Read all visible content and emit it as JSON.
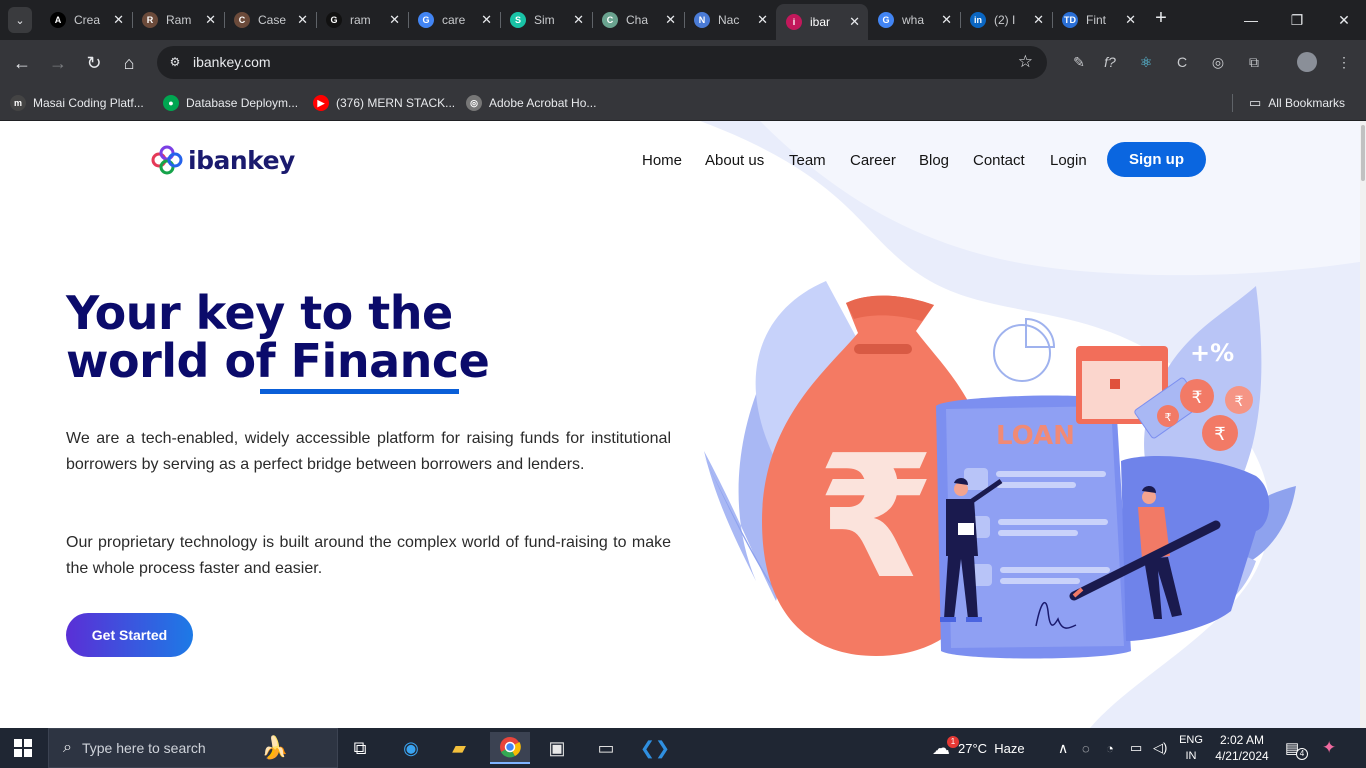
{
  "browser": {
    "tabs": [
      {
        "title": "Crea",
        "favicon": "A",
        "color": "#000000"
      },
      {
        "title": "Ram",
        "favicon": "R",
        "color": "#6b4a3a"
      },
      {
        "title": "Case",
        "favicon": "C",
        "color": "#6b4a3a"
      },
      {
        "title": "ram",
        "favicon": "G",
        "color": "#111111"
      },
      {
        "title": "care",
        "favicon": "G",
        "color": "#4285f4"
      },
      {
        "title": "Sim",
        "favicon": "S",
        "color": "#19c3a6"
      },
      {
        "title": "Cha",
        "favicon": "C",
        "color": "#6aa38f"
      },
      {
        "title": "Nac",
        "favicon": "N",
        "color": "#4a7bd6"
      },
      {
        "title": "ibar",
        "favicon": "i",
        "color": "#c2185b"
      },
      {
        "title": "wha",
        "favicon": "G",
        "color": "#4285f4"
      },
      {
        "title": "(2) I",
        "favicon": "in",
        "color": "#0a66c2"
      },
      {
        "title": "Fint",
        "favicon": "TD",
        "color": "#2a6fd6"
      }
    ],
    "active_tab_index": 8,
    "url": "ibankey.com",
    "bookmarks": [
      {
        "label": "Masai Coding Platf...",
        "icon": "m",
        "color": "#444444"
      },
      {
        "label": "Database Deploym...",
        "icon": "●",
        "color": "#00a651"
      },
      {
        "label": "(376) MERN STACK...",
        "icon": "▶",
        "color": "#ff0000"
      },
      {
        "label": "Adobe Acrobat Ho...",
        "icon": "◎",
        "color": "#777777"
      }
    ],
    "all_bookmarks": "All Bookmarks"
  },
  "site": {
    "logo_text": "ibankey",
    "nav": [
      "Home",
      "About us",
      "Team",
      "Career",
      "Blog",
      "Contact",
      "Login"
    ],
    "signup": "Sign up",
    "hero": {
      "title_line1": "Your key to the",
      "title_line2_prefix": "world of ",
      "title_line2_accent": "Finance",
      "para1": "We are a tech-enabled, widely accessible platform for raising funds for institutional borrowers by serving as a perfect bridge between borrowers and lenders.",
      "para2": "Our proprietary technology is built around the complex world of fund-raising to make the whole process faster and easier.",
      "cta": "Get Started"
    },
    "illustration": {
      "loan_label": "LOAN",
      "currency_symbol": "₹",
      "plus_percent": "+%"
    }
  },
  "taskbar": {
    "search_placeholder": "Type here to search",
    "weather": "27°C  Haze",
    "language": "ENG",
    "region": "IN",
    "time": "2:02 AM",
    "date": "4/21/2024",
    "notifications": "4",
    "weather_badge": "1"
  }
}
